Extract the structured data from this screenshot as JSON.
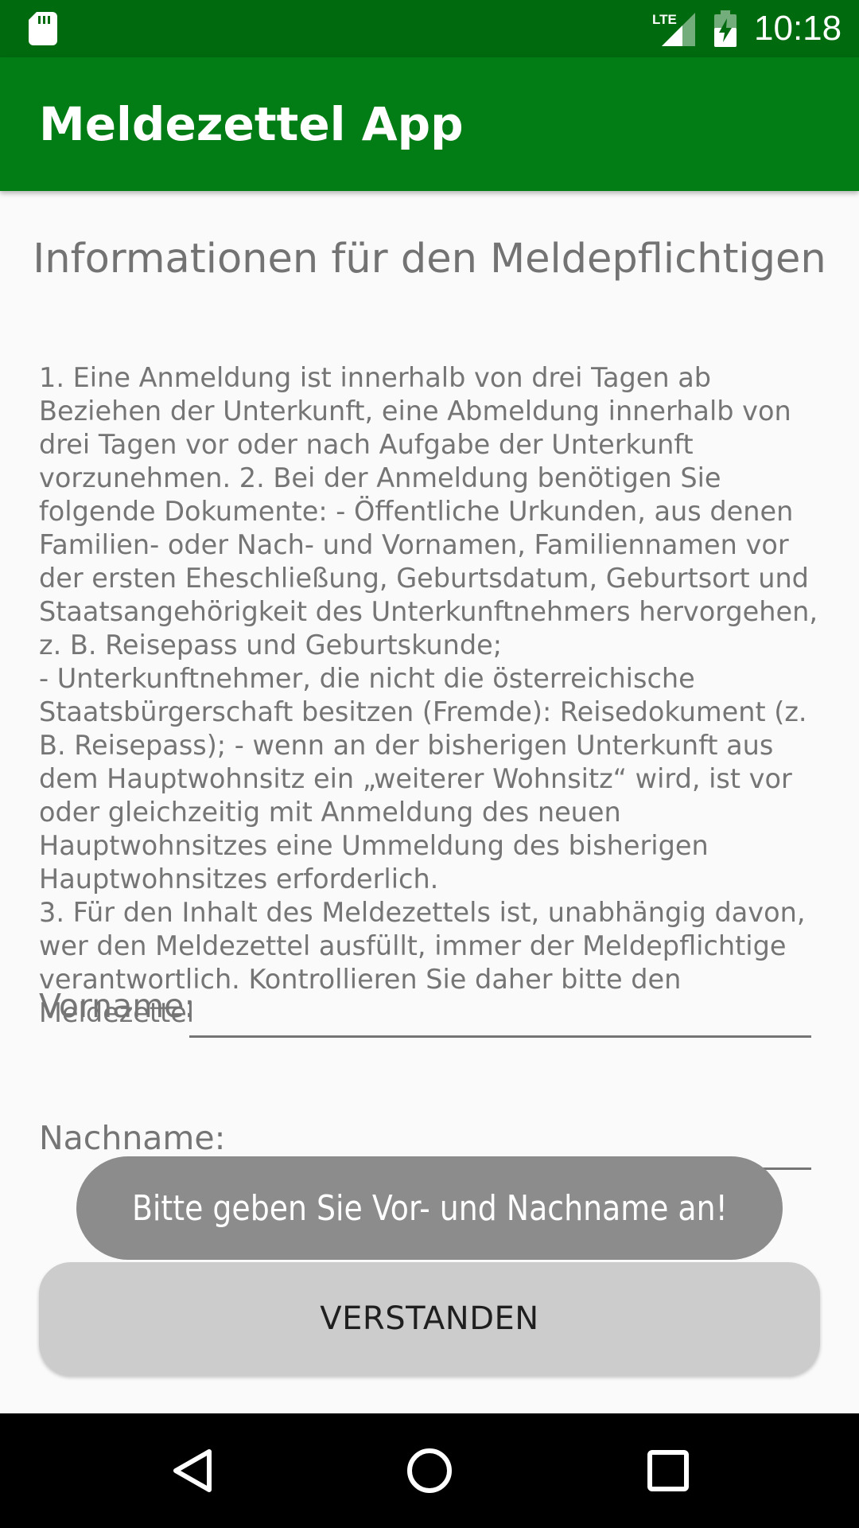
{
  "status_bar": {
    "time": "10:18",
    "network": "LTE",
    "icons": [
      "sd-card-icon",
      "lte-signal-icon",
      "battery-charging-icon"
    ]
  },
  "app_bar": {
    "title": "Meldezettel App",
    "color": "#027c14"
  },
  "main": {
    "heading": "Informationen für den Meldepflichtigen",
    "info_text": "1. Eine Anmeldung ist innerhalb von drei Tagen ab Beziehen der Unterkunft, eine Abmeldung innerhalb von drei Tagen vor oder nach Aufgabe der Unterkunft vorzunehmen. 2. Bei der Anmeldung benötigen Sie folgende Dokumente: - Öffentliche Urkunden, aus denen Familien- oder Nach- und Vornamen, Familiennamen vor der ersten Eheschließung, Geburtsdatum, Geburtsort und Staatsangehörigkeit des Unterkunftnehmers hervorgehen, z. B. Reisepass und Geburtskunde;\n- Unterkunftnehmer, die nicht die österreichische Staatsbürgerschaft besitzen (Fremde): Reisedokument (z. B. Reisepass); - wenn an der bisherigen Unterkunft aus dem Hauptwohnsitz ein „weiterer Wohnsitz“ wird, ist vor oder gleichzeitig mit Anmeldung des neuen Hauptwohnsitzes eine Ummeldung des bisherigen Hauptwohnsitzes erforderlich.\n3. Für den Inhalt des Meldezettels ist, unabhängig davon, wer den Meldezettel ausfüllt, immer der Meldepflichtige verantwortlich. Kontrollieren Sie daher bitte den Meldezettel",
    "first_name_label": "Vorname:",
    "first_name_value": "",
    "last_name_label": "Nachname:",
    "last_name_value": "",
    "confirm_button": "VERSTANDEN"
  },
  "toast": {
    "message": "Bitte geben Sie Vor- und Nachname an!"
  },
  "nav_bar": {
    "icons": [
      "back-icon",
      "home-icon",
      "recent-apps-icon"
    ]
  }
}
